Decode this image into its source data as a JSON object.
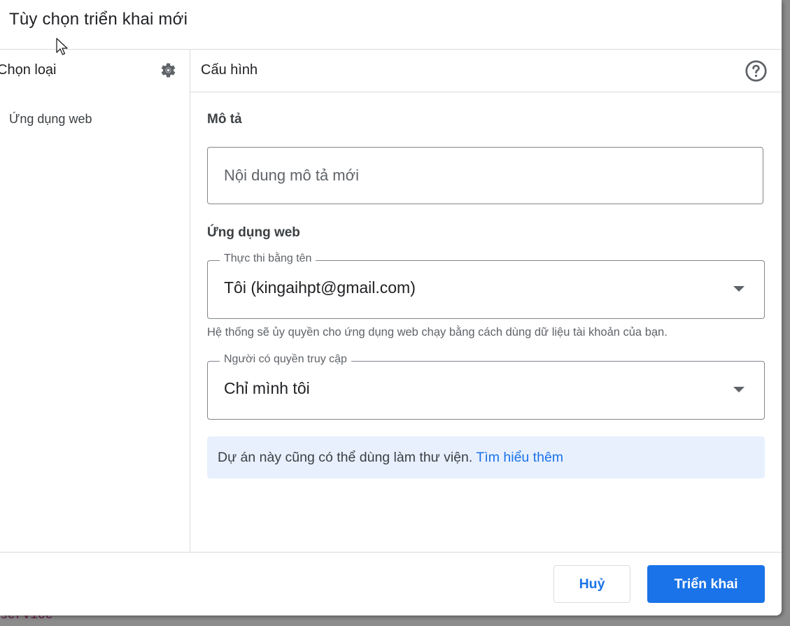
{
  "dialog": {
    "title": "Tùy chọn triển khai mới"
  },
  "left_panel": {
    "title": "Chọn loại",
    "settings_icon": "gear-icon",
    "items": [
      {
        "label": "Ứng dụng web"
      }
    ]
  },
  "right_panel": {
    "title": "Cấu hình",
    "help_icon": "help-circle-icon",
    "description": {
      "label": "Mô tả",
      "placeholder": "Nội dung mô tả mới",
      "value": ""
    },
    "web_app": {
      "section_label": "Ứng dụng web",
      "execute_as": {
        "label": "Thực thi bằng tên",
        "value": "Tôi (kingaihpt@gmail.com)"
      },
      "execute_hint": "Hệ thống sẽ ủy quyền cho ứng dụng web chạy bằng cách dùng dữ liệu tài khoản của bạn.",
      "access": {
        "label": "Người có quyền truy cập",
        "value": "Chỉ mình tôi"
      }
    },
    "info": {
      "text": "Dự án này cũng có thể dùng làm thư viện.",
      "link": "Tìm hiểu thêm"
    }
  },
  "footer": {
    "cancel_label": "Huỷ",
    "deploy_label": "Triển khai"
  },
  "background": {
    "code_text": "service"
  },
  "colors": {
    "accent": "#1a73e8",
    "info_bg": "#e8f0fe",
    "border": "#80868b",
    "divider": "#dadce0"
  }
}
